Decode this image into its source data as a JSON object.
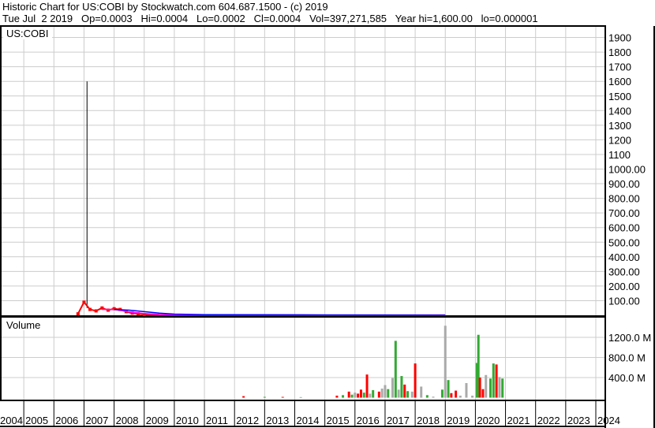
{
  "header": {
    "title": "Historic Chart for US:COBI by Stockwatch.com 604.687.1500 - (c) 2019",
    "quote": "Tue Jul  2 2019   Op=0.0003   Hi=0.0004   Lo=0.0002   Cl=0.0004   Vol=397,271,585   Year hi=1,600.00   lo=0.000001"
  },
  "chart_data": [
    {
      "type": "line",
      "title": "US:COBI",
      "ylim": [
        0,
        1950
      ],
      "y_ticks": [
        "1900",
        "1800",
        "1700",
        "1600",
        "1500",
        "1400",
        "1300",
        "1200",
        "1100",
        "1000.00",
        "900.00",
        "800.00",
        "700.00",
        "600.00",
        "500.00",
        "400.00",
        "300.00",
        "200.00",
        "100.00"
      ],
      "y_tick_values": [
        1900,
        1800,
        1700,
        1600,
        1500,
        1400,
        1300,
        1200,
        1100,
        1000,
        900,
        800,
        700,
        600,
        500,
        400,
        300,
        200,
        100
      ],
      "x_ticks": [
        "2004",
        "2005",
        "2006",
        "2007",
        "2008",
        "2009",
        "2010",
        "2011",
        "2012",
        "2013",
        "2014",
        "2015",
        "2016",
        "2017",
        "2018",
        "2019",
        "2020",
        "2021",
        "2022",
        "2023",
        "2024"
      ],
      "spike": {
        "x": 2007.1,
        "high": 1600,
        "low": 50
      },
      "series": [
        {
          "name": "price",
          "color": "#ff0000",
          "x": [
            2006.8,
            2007.0,
            2007.2,
            2007.4,
            2007.6,
            2007.8,
            2008.0,
            2008.2,
            2008.4,
            2008.6,
            2008.8,
            2009.0,
            2009.5,
            2010,
            2015,
            2019.0
          ],
          "y": [
            10,
            90,
            40,
            30,
            50,
            35,
            45,
            40,
            25,
            15,
            10,
            5,
            3,
            2,
            1,
            1
          ]
        },
        {
          "name": "ma-short",
          "color": "#ff00ff",
          "x": [
            2007.6,
            2008.0,
            2008.3,
            2008.6,
            2009.0,
            2009.5,
            2010,
            2015,
            2019
          ],
          "y": [
            40,
            40,
            30,
            20,
            12,
            6,
            3,
            1,
            1
          ]
        },
        {
          "name": "ma-long",
          "color": "#0000ff",
          "x": [
            2008.0,
            2008.5,
            2009.0,
            2009.5,
            2010,
            2011,
            2015,
            2019
          ],
          "y": [
            40,
            35,
            25,
            15,
            8,
            4,
            2,
            1
          ]
        }
      ]
    },
    {
      "type": "bar",
      "title": "Volume",
      "ylim": [
        0,
        1600
      ],
      "y_ticks": [
        "1200.0 M",
        "800.0 M",
        "400.0 M"
      ],
      "y_tick_values": [
        1200,
        800,
        400
      ],
      "unit": "M",
      "bars": [
        {
          "x": 2012.3,
          "v": 30,
          "c": "r"
        },
        {
          "x": 2013.0,
          "v": 15,
          "c": "g"
        },
        {
          "x": 2013.6,
          "v": 15,
          "c": "r"
        },
        {
          "x": 2014.2,
          "v": 10,
          "c": "g"
        },
        {
          "x": 2015.4,
          "v": 40,
          "c": "r"
        },
        {
          "x": 2015.6,
          "v": 50,
          "c": "g"
        },
        {
          "x": 2015.8,
          "v": 120,
          "c": "r"
        },
        {
          "x": 2015.9,
          "v": 60,
          "c": "g"
        },
        {
          "x": 2016.0,
          "v": 100,
          "c": "y"
        },
        {
          "x": 2016.1,
          "v": 80,
          "c": "r"
        },
        {
          "x": 2016.2,
          "v": 160,
          "c": "r"
        },
        {
          "x": 2016.3,
          "v": 100,
          "c": "g"
        },
        {
          "x": 2016.4,
          "v": 460,
          "c": "r"
        },
        {
          "x": 2016.5,
          "v": 80,
          "c": "y"
        },
        {
          "x": 2016.6,
          "v": 150,
          "c": "g"
        },
        {
          "x": 2016.8,
          "v": 120,
          "c": "r"
        },
        {
          "x": 2016.9,
          "v": 180,
          "c": "y"
        },
        {
          "x": 2017.0,
          "v": 250,
          "c": "y"
        },
        {
          "x": 2017.1,
          "v": 170,
          "c": "g"
        },
        {
          "x": 2017.25,
          "v": 390,
          "c": "y"
        },
        {
          "x": 2017.35,
          "v": 1130,
          "c": "g"
        },
        {
          "x": 2017.45,
          "v": 160,
          "c": "y"
        },
        {
          "x": 2017.55,
          "v": 430,
          "c": "g"
        },
        {
          "x": 2017.65,
          "v": 260,
          "c": "r"
        },
        {
          "x": 2017.75,
          "v": 130,
          "c": "g"
        },
        {
          "x": 2017.9,
          "v": 120,
          "c": "y"
        },
        {
          "x": 2018.0,
          "v": 680,
          "c": "r"
        },
        {
          "x": 2018.2,
          "v": 220,
          "c": "y"
        },
        {
          "x": 2018.4,
          "v": 50,
          "c": "g"
        },
        {
          "x": 2018.6,
          "v": 20,
          "c": "y"
        },
        {
          "x": 2018.9,
          "v": 160,
          "c": "g"
        },
        {
          "x": 2019.0,
          "v": 1430,
          "c": "y"
        },
        {
          "x": 2019.1,
          "v": 350,
          "c": "g"
        },
        {
          "x": 2019.2,
          "v": 90,
          "c": "r"
        },
        {
          "x": 2019.35,
          "v": 140,
          "c": "r"
        },
        {
          "x": 2019.5,
          "v": 40,
          "c": "y"
        },
        {
          "x": 2019.7,
          "v": 290,
          "c": "y"
        },
        {
          "x": 2019.9,
          "v": 40,
          "c": "y"
        },
        {
          "x": 2020.05,
          "v": 690,
          "c": "g"
        },
        {
          "x": 2020.1,
          "v": 1250,
          "c": "g"
        },
        {
          "x": 2020.15,
          "v": 400,
          "c": "r"
        },
        {
          "x": 2020.25,
          "v": 170,
          "c": "r"
        },
        {
          "x": 2020.35,
          "v": 450,
          "c": "y"
        },
        {
          "x": 2020.5,
          "v": 380,
          "c": "g"
        },
        {
          "x": 2020.6,
          "v": 680,
          "c": "g"
        },
        {
          "x": 2020.7,
          "v": 660,
          "c": "r"
        },
        {
          "x": 2020.8,
          "v": 410,
          "c": "y"
        },
        {
          "x": 2020.9,
          "v": 380,
          "c": "g"
        }
      ]
    }
  ],
  "colors": {
    "up": "#33aa33",
    "down": "#ff0000",
    "neutral": "#aaaaaa",
    "grid": "#cccccc"
  }
}
